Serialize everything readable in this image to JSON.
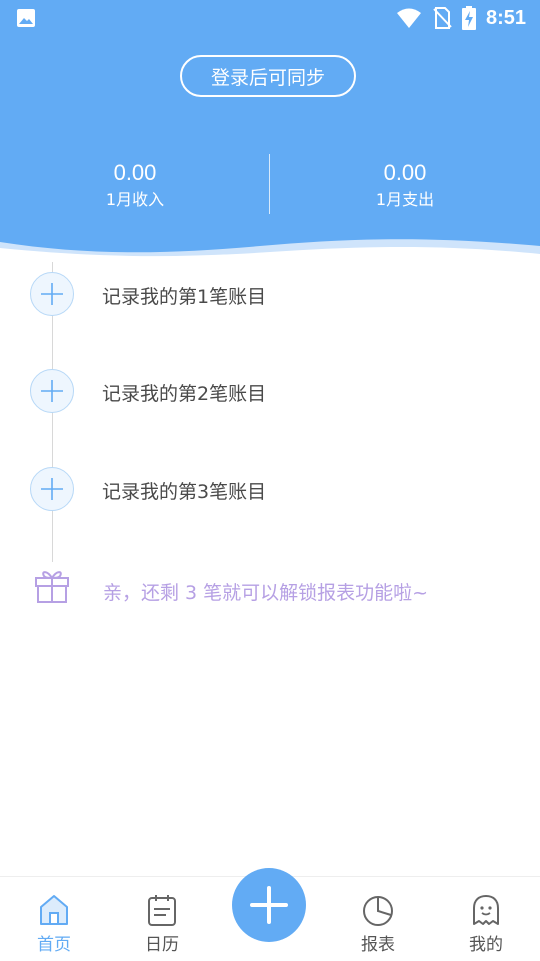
{
  "status_bar": {
    "time": "8:51"
  },
  "header": {
    "sync_button": "登录后可同步",
    "income": {
      "value": "0.00",
      "label": "1月收入"
    },
    "expense": {
      "value": "0.00",
      "label": "1月支出"
    }
  },
  "entries": [
    {
      "label": "记录我的第1笔账目"
    },
    {
      "label": "记录我的第2笔账目"
    },
    {
      "label": "记录我的第3笔账目"
    }
  ],
  "unlock_hint": "亲，还剩 3 笔就可以解锁报表功能啦~",
  "nav": {
    "items": [
      {
        "label": "首页",
        "icon": "home-icon"
      },
      {
        "label": "日历",
        "icon": "calendar-icon"
      },
      {
        "label": "报表",
        "icon": "pie-chart-icon"
      },
      {
        "label": "我的",
        "icon": "ghost-icon"
      }
    ],
    "add_icon": "plus-icon"
  },
  "colors": {
    "primary": "#62abf4",
    "hint": "#b6a0e4",
    "text": "#4a4a4a"
  }
}
